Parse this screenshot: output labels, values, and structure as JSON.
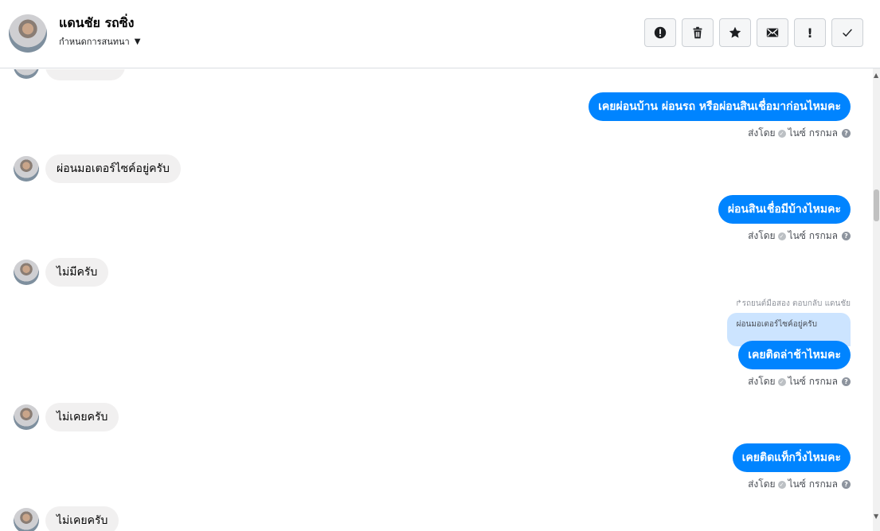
{
  "header": {
    "name": "แดนชัย รถซิ่ง",
    "subtitle": "กำหนดการสนทนา"
  },
  "toolbar": {
    "buttons": [
      {
        "icon": "alert-circle-icon",
        "glyph": "!"
      },
      {
        "icon": "trash-icon",
        "glyph": ""
      },
      {
        "icon": "star-icon",
        "glyph": "★"
      },
      {
        "icon": "envelope-icon",
        "glyph": "✉"
      },
      {
        "icon": "exclamation-icon",
        "glyph": "!"
      },
      {
        "icon": "checkmark-icon",
        "glyph": "✓"
      }
    ]
  },
  "messages": [
    {
      "dir": "out",
      "text": "เคยผ่อนบ้าน ผ่อนรถ หรือผ่อนสินเชื่อมาก่อนไหมคะ",
      "sent_by_label": "ส่งโดย",
      "sender": "ไนซ์ กรกมล"
    },
    {
      "dir": "in",
      "text": "ผ่อนมอเตอร์ไซค์อยู่ครับ"
    },
    {
      "dir": "out",
      "text": "ผ่อนสินเชื่อมีบ้างไหมคะ",
      "sent_by_label": "ส่งโดย",
      "sender": "ไนซ์ กรกมล"
    },
    {
      "dir": "in",
      "text": "ไม่มีครับ"
    },
    {
      "dir": "out",
      "reply_note": "รถยนต์มือสอง ตอบกลับ แดนชัย",
      "quote": "ผ่อนมอเตอร์ไซค์อยู่ครับ",
      "text": "เคยติดล่าช้าไหมคะ",
      "sent_by_label": "ส่งโดย",
      "sender": "ไนซ์ กรกมล"
    },
    {
      "dir": "in",
      "text": "ไม่เคยครับ"
    },
    {
      "dir": "out",
      "text": "เคยติดแท็กวิ่งไหมคะ",
      "sent_by_label": "ส่งโดย",
      "sender": "ไนซ์ กรกมล"
    },
    {
      "dir": "in",
      "text": "ไม่เคยครับ"
    }
  ]
}
